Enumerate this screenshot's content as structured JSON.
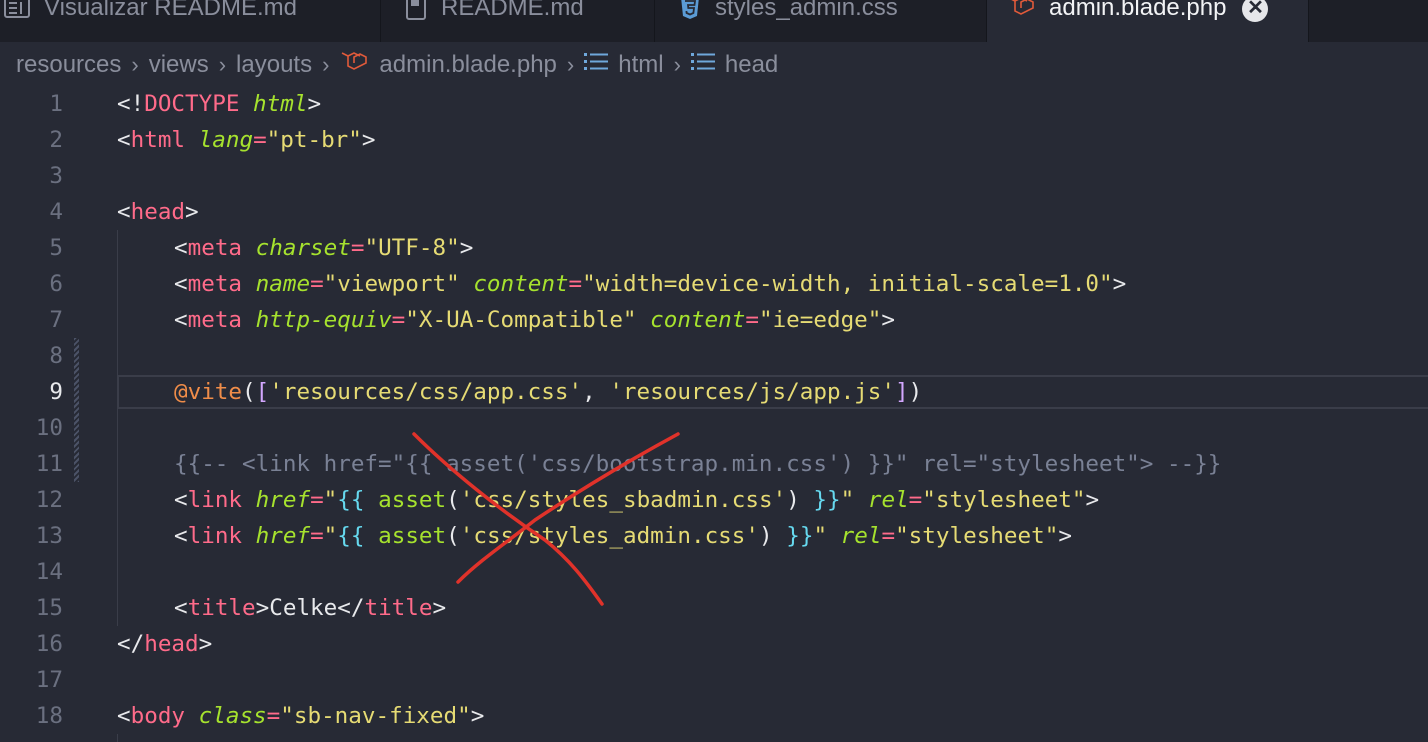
{
  "tabs": [
    {
      "label": "Visualizar README.md",
      "icon": "preview-icon",
      "active": false
    },
    {
      "label": "README.md",
      "icon": "book-icon",
      "active": false
    },
    {
      "label": "styles_admin.css",
      "icon": "css3-icon",
      "active": false
    },
    {
      "label": "admin.blade.php",
      "icon": "laravel-icon",
      "active": true,
      "close": "✕"
    }
  ],
  "breadcrumb": {
    "items": [
      "resources",
      "views",
      "layouts",
      "admin.blade.php",
      "html",
      "head"
    ],
    "separator": "›"
  },
  "editor": {
    "current_line": 9,
    "lines": [
      {
        "n": "1"
      },
      {
        "n": "2"
      },
      {
        "n": "3"
      },
      {
        "n": "4"
      },
      {
        "n": "5"
      },
      {
        "n": "6"
      },
      {
        "n": "7"
      },
      {
        "n": "8"
      },
      {
        "n": "9"
      },
      {
        "n": "10"
      },
      {
        "n": "11"
      },
      {
        "n": "12"
      },
      {
        "n": "13"
      },
      {
        "n": "14"
      },
      {
        "n": "15"
      },
      {
        "n": "16"
      },
      {
        "n": "17"
      },
      {
        "n": "18"
      }
    ],
    "tokens": {
      "l1": [
        "<!",
        "DOCTYPE",
        " ",
        "html",
        ">"
      ],
      "l2": [
        "<",
        "html",
        " ",
        "lang",
        "=",
        "\"pt-br\"",
        ">"
      ],
      "l4": [
        "<",
        "head",
        ">"
      ],
      "l5": [
        "<",
        "meta",
        " ",
        "charset",
        "=",
        "\"UTF-8\"",
        ">"
      ],
      "l6": [
        "<",
        "meta",
        " ",
        "name",
        "=",
        "\"viewport\"",
        " ",
        "content",
        "=",
        "\"width=device-width, initial-scale=1.0\"",
        ">"
      ],
      "l7": [
        "<",
        "meta",
        " ",
        "http-equiv",
        "=",
        "\"X-UA-Compatible\"",
        " ",
        "content",
        "=",
        "\"ie=edge\"",
        ">"
      ],
      "l9": [
        "@vite",
        "(",
        "[",
        "'resources/css/app.css'",
        ", ",
        "'resources/js/app.js'",
        "]",
        ")"
      ],
      "l11": [
        "{{-- <link href=\"{{ asset('css/bootstrap.min.css') }}\" rel=\"stylesheet\"> --}}"
      ],
      "l12": [
        "<",
        "link",
        " ",
        "href",
        "=",
        "\"",
        "{{",
        " ",
        "asset",
        "(",
        "'css/styles_sbadmin.css'",
        ")",
        " ",
        "}}",
        "\"",
        " ",
        "rel",
        "=",
        "\"stylesheet\"",
        ">"
      ],
      "l13": [
        "<",
        "link",
        " ",
        "href",
        "=",
        "\"",
        "{{",
        " ",
        "asset",
        "(",
        "'css/styles_admin.css'",
        ")",
        " ",
        "}}",
        "\"",
        " ",
        "rel",
        "=",
        "\"stylesheet\"",
        ">"
      ],
      "l15": [
        "<",
        "title",
        ">",
        "Celke",
        "</",
        "title",
        ">"
      ],
      "l16": [
        "</",
        "head",
        ">"
      ],
      "l18": [
        "<",
        "body",
        " ",
        "class",
        "=",
        "\"sb-nav-fixed\"",
        ">"
      ]
    }
  },
  "colors": {
    "background": "#272a35",
    "tabbar": "#1d1f27",
    "tag": "#ff6b8a",
    "attribute": "#a6e22e",
    "string": "#e6db74",
    "comment": "#7a8195",
    "annotation": "#e0322a"
  }
}
